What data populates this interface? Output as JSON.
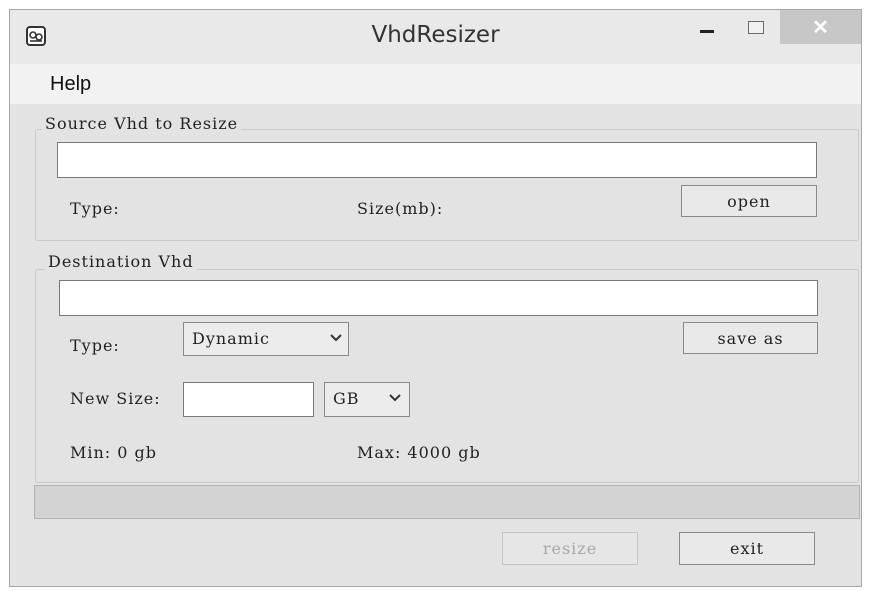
{
  "window": {
    "title": "VhdResizer",
    "close_glyph": "✕",
    "icons": {
      "app": "app-icon",
      "minimize": "minimize-icon",
      "maximize": "maximize-icon",
      "close": "close-icon"
    }
  },
  "menu": {
    "items": [
      {
        "label": "Help"
      }
    ]
  },
  "source": {
    "group_label": "Source Vhd to Resize",
    "path_value": "",
    "type_label": "Type:",
    "size_label": "Size(mb):",
    "open_label": "open"
  },
  "destination": {
    "group_label": "Destination Vhd",
    "path_value": "",
    "type_label": "Type:",
    "type_selected": "Dynamic",
    "save_as_label": "save as",
    "new_size_label": "New Size:",
    "new_size_value": "",
    "unit_selected": "GB",
    "min_label": "Min: 0 gb",
    "max_label": "Max: 4000 gb"
  },
  "progress": {
    "value": 0
  },
  "actions": {
    "resize_label": "resize",
    "exit_label": "exit"
  }
}
